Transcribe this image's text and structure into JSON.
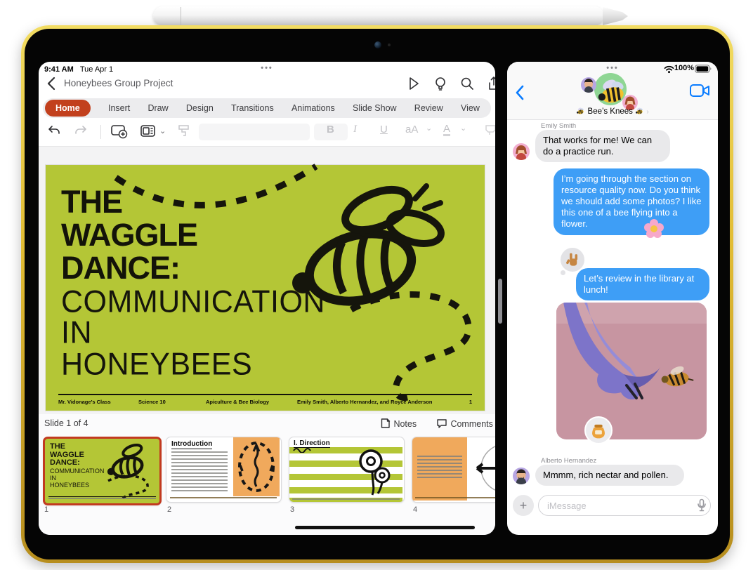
{
  "device": {
    "status_left": {
      "time": "9:41 AM",
      "date": "Tue Apr 1"
    },
    "status_right": {
      "battery_percent": "100%"
    },
    "window_controls_dots": "•••"
  },
  "powerpoint": {
    "nav": {
      "title": "Honeybees Group Project"
    },
    "ribbon": {
      "tabs": [
        "Home",
        "Insert",
        "Draw",
        "Design",
        "Transitions",
        "Animations",
        "Slide Show",
        "Review",
        "View"
      ],
      "active_tab": "Home"
    },
    "format_toolbar": {
      "bold": "B",
      "italic": "I",
      "underline": "U",
      "text_size": "aA",
      "font_color": "A"
    },
    "slide": {
      "title_bold_lines": [
        "THE",
        "WAGGLE",
        "DANCE:"
      ],
      "title_light_lines": [
        "COMMUNICATION",
        "IN",
        "HONEYBEES"
      ],
      "footer": {
        "teacher": "Mr. Vidonage’s Class",
        "course": "Science 10",
        "unit": "Apiculture & Bee Biology",
        "authors": "Emily Smith, Alberto Hernandez, and Royce Anderson",
        "page_number": "1"
      }
    },
    "status_row": {
      "slide_counter": "Slide 1 of 4",
      "notes_label": "Notes",
      "comments_label": "Comments"
    },
    "thumbnails": [
      {
        "number": "1",
        "selected": true
      },
      {
        "number": "2",
        "selected": false,
        "title": "Introduction"
      },
      {
        "number": "3",
        "selected": false,
        "title": "I. Direction"
      },
      {
        "number": "4",
        "selected": false
      }
    ]
  },
  "messages": {
    "header": {
      "group_name": "Bee’s Knees",
      "group_name_emoji": "🐝"
    },
    "conversation": [
      {
        "type": "sender_label",
        "text": "Emily Smith"
      },
      {
        "type": "received",
        "sender": "Emily Smith",
        "text": "That works for me! We can do a practice run."
      },
      {
        "type": "sent",
        "text": "I’m going through the section on resource quality now. Do you think we should add some photos? I like this one of a bee flying into a flower.",
        "trailing_emoji": "🌸"
      },
      {
        "type": "sent",
        "text": "Let’s review in the library at lunch!",
        "tapback": "🤟"
      },
      {
        "type": "sent_photo",
        "description": "bee flying toward purple flower on pink background",
        "tapback": "🍯"
      },
      {
        "type": "sender_label",
        "text": "Alberto Hernandez"
      },
      {
        "type": "received",
        "sender": "Alberto Hernandez",
        "text": "Mmmm, rich nectar and pollen."
      }
    ],
    "composer": {
      "placeholder": "iMessage"
    }
  },
  "colors": {
    "powerpoint_red": "#C2401D",
    "imessage_blue": "#3E9EF6",
    "slide_green": "#B4C636",
    "ipad_yellow": "#E8C63F",
    "group_avatar_green": "#8FD694"
  }
}
